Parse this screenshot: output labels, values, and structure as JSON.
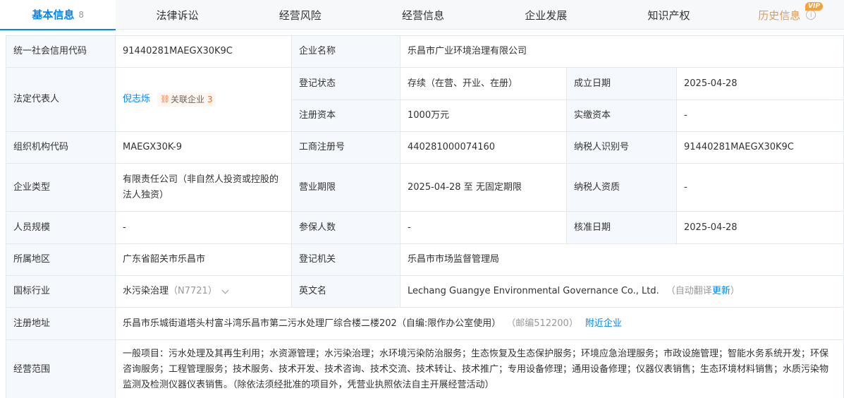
{
  "tabs": [
    {
      "label": "基本信息",
      "badge": "8"
    },
    {
      "label": "法律诉讼"
    },
    {
      "label": "经营风险"
    },
    {
      "label": "经营信息"
    },
    {
      "label": "企业发展"
    },
    {
      "label": "知识产权"
    },
    {
      "label": "历史信息",
      "vip": "VIP"
    }
  ],
  "fields": {
    "credit_code": {
      "label": "统一社会信用代码",
      "value": "91440281MAEGX30K9C"
    },
    "company_name": {
      "label": "企业名称",
      "value": "乐昌市广业环境治理有限公司"
    },
    "legal_rep": {
      "label": "法定代表人",
      "value": "倪志烁",
      "related_label": "关联企业",
      "related_count": "3"
    },
    "reg_status": {
      "label": "登记状态",
      "value": "存续（在营、开业、在册）"
    },
    "est_date": {
      "label": "成立日期",
      "value": "2025-04-28"
    },
    "reg_capital": {
      "label": "注册资本",
      "value": "1000万元"
    },
    "paid_capital": {
      "label": "实缴资本",
      "value": "-"
    },
    "org_code": {
      "label": "组织机构代码",
      "value": "MAEGX30K-9"
    },
    "biz_reg_no": {
      "label": "工商注册号",
      "value": "440281000074160"
    },
    "taxpayer_id": {
      "label": "纳税人识别号",
      "value": "91440281MAEGX30K9C"
    },
    "company_type": {
      "label": "企业类型",
      "value": "有限责任公司（非自然人投资或控股的法人独资）"
    },
    "biz_term": {
      "label": "营业期限",
      "value": "2025-04-28 至 无固定期限"
    },
    "taxpayer_qual": {
      "label": "纳税人资质",
      "value": "-"
    },
    "staff_size": {
      "label": "人员规模",
      "value": "-"
    },
    "insured": {
      "label": "参保人数",
      "value": "-"
    },
    "approve_date": {
      "label": "核准日期",
      "value": "2025-04-28"
    },
    "region": {
      "label": "所属地区",
      "value": "广东省韶关市乐昌市"
    },
    "reg_authority": {
      "label": "登记机关",
      "value": "乐昌市市场监督管理局"
    },
    "industry": {
      "label": "国标行业",
      "value": "水污染治理",
      "code": "（N7721）"
    },
    "english_name": {
      "label": "英文名",
      "value": "Lechang Guangye Environmental Governance Co., Ltd.",
      "note": "（自动翻译",
      "update": "更新",
      "note_end": "）"
    },
    "reg_address": {
      "label": "注册地址",
      "value": "乐昌市乐城街道塔头村富斗湾乐昌市第二污水处理厂综合楼二楼202（自编:限作办公室使用）",
      "postcode": "（邮编512200）",
      "nearby": "附近企业"
    },
    "biz_scope": {
      "label": "经营范围",
      "value": "一般项目：污水处理及其再生利用；水资源管理；水污染治理；水环境污染防治服务；生态恢复及生态保护服务；环境应急治理服务；市政设施管理；智能水务系统开发；环保咨询服务；工程管理服务；技术服务、技术开发、技术咨询、技术交流、技术转让、技术推广；专用设备修理；通用设备修理；仪器仪表销售；生态环境材料销售；水质污染物监测及检测仪器仪表销售。（除依法须经批准的项目外，凭营业执照依法自主开展经营活动）"
    }
  }
}
